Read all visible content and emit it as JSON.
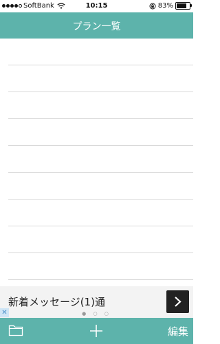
{
  "status": {
    "carrier": "SoftBank",
    "time": "10:15",
    "battery_percent": "83%",
    "battery_level": 0.83,
    "wifi_icon": "wifi-icon",
    "rotation_lock_icon": "rotation-lock-icon"
  },
  "nav": {
    "title": "プラン一覧"
  },
  "list": {
    "row_count": 9
  },
  "ad": {
    "text": "新着メッセージ(1)通",
    "pager": "● ○ ○",
    "close_label": "✕",
    "arrow_icon": "chevron-right-icon"
  },
  "tabbar": {
    "folder_icon": "folder-icon",
    "add_icon": "plus-icon",
    "edit_label": "編集"
  },
  "colors": {
    "accent": "#5db3ab"
  }
}
